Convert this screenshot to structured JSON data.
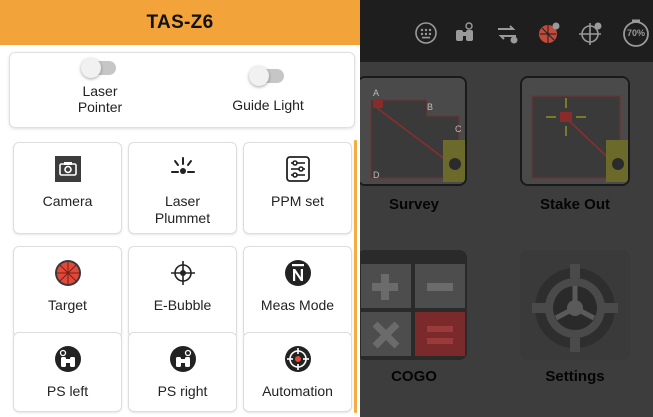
{
  "drawer": {
    "title": "TAS-Z6",
    "toggles": [
      {
        "label_line1": "Laser",
        "label_line2": "Pointer",
        "state": "off"
      },
      {
        "label_line1": "Guide Light",
        "label_line2": "",
        "state": "off"
      }
    ],
    "buttons": [
      {
        "label_line1": "Camera",
        "label_line2": "",
        "icon": "camera-icon"
      },
      {
        "label_line1": "Laser",
        "label_line2": "Plummet",
        "icon": "laser-plummet-icon"
      },
      {
        "label_line1": "PPM set",
        "label_line2": "",
        "icon": "sliders-icon"
      },
      {
        "label_line1": "Target",
        "label_line2": "",
        "icon": "target-prism-icon"
      },
      {
        "label_line1": "E-Bubble",
        "label_line2": "",
        "icon": "crosshair-icon"
      },
      {
        "label_line1": "Meas Mode",
        "label_line2": "",
        "icon": "n-bar-icon"
      },
      {
        "label_line1": "PS left",
        "label_line2": "",
        "icon": "binoculars-left-icon"
      },
      {
        "label_line1": "PS right",
        "label_line2": "",
        "icon": "binoculars-right-icon"
      },
      {
        "label_line1": "Automation",
        "label_line2": "",
        "icon": "automation-target-icon"
      }
    ]
  },
  "background": {
    "battery": "70%",
    "tiles": [
      {
        "label": "Survey"
      },
      {
        "label": "Stake Out"
      },
      {
        "label": "COGO"
      },
      {
        "label": "Settings"
      }
    ],
    "tile_letters": {
      "a": "A",
      "b": "B",
      "c": "C",
      "d": "D"
    }
  },
  "colors": {
    "accent": "#f2a43a",
    "target_red": "#e14a3a"
  }
}
